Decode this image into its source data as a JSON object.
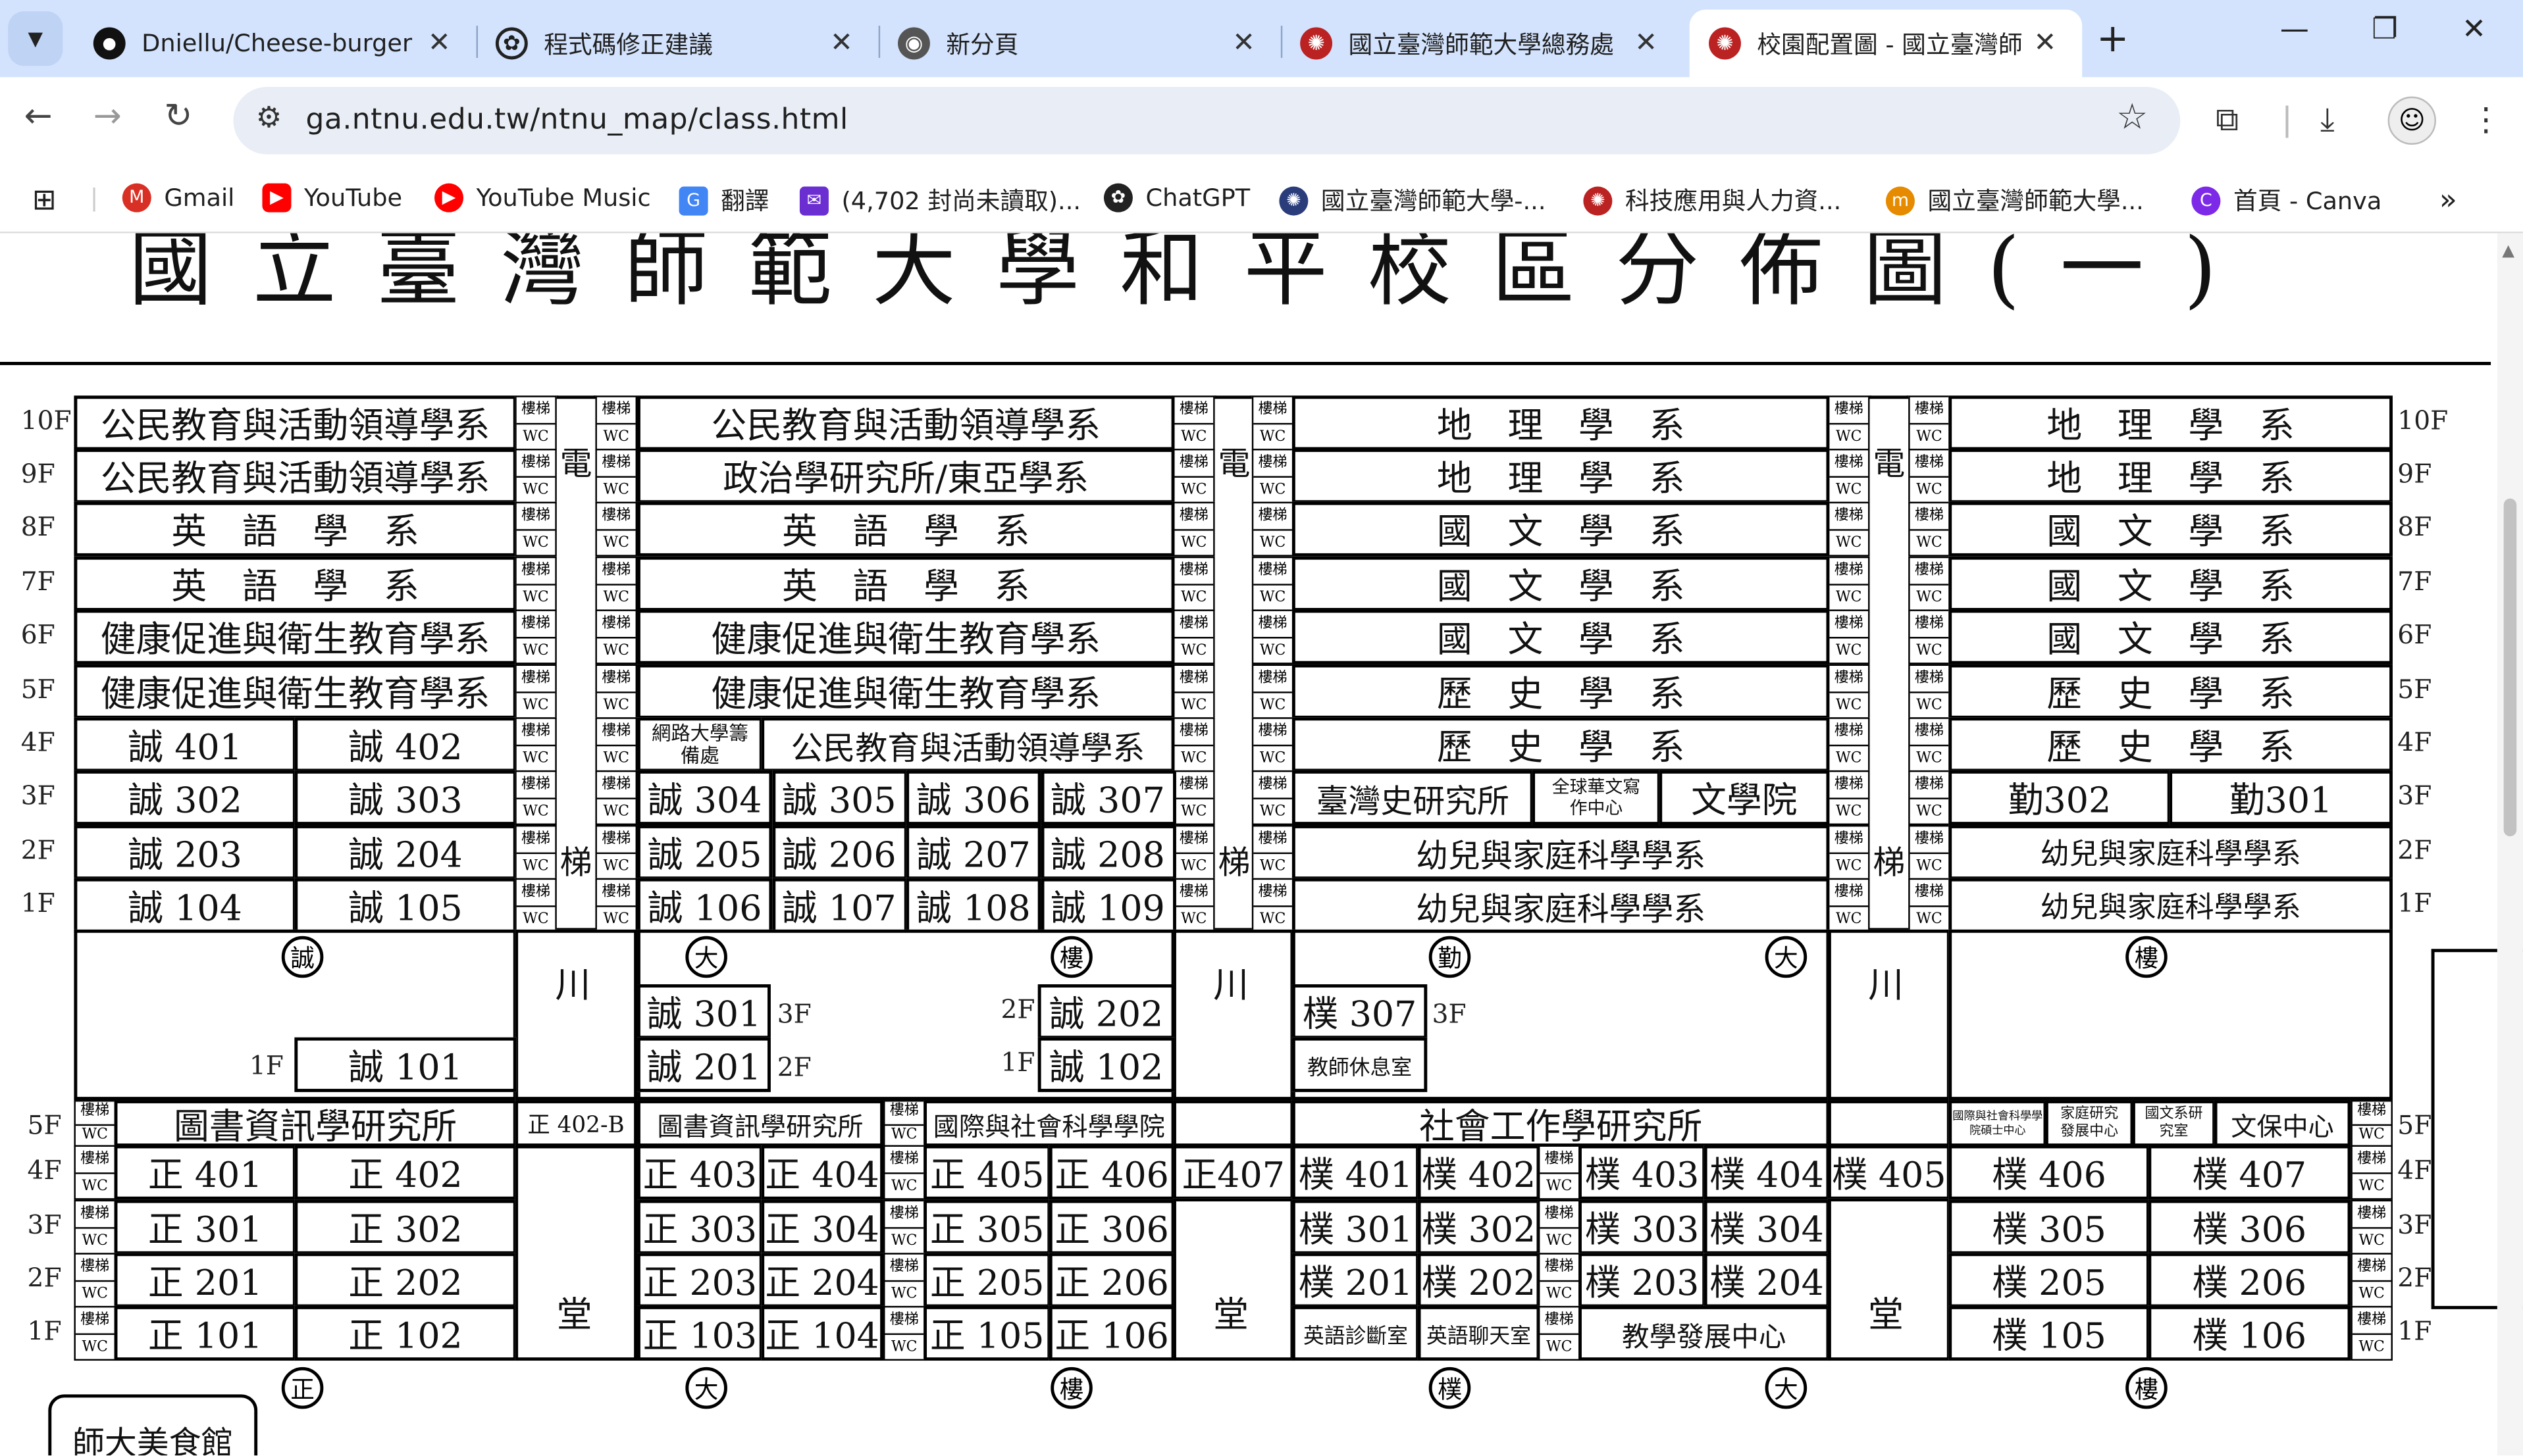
{
  "tabs": [
    {
      "icon": "github-icon",
      "title": "Dniellu/Cheese-burger"
    },
    {
      "icon": "openai-icon",
      "title": "程式碼修正建議"
    },
    {
      "icon": "chrome-icon",
      "title": "新分頁"
    },
    {
      "icon": "ntnu-icon",
      "title": "國立臺灣師範大學總務處"
    },
    {
      "icon": "ntnu-icon",
      "title": "校園配置圖 - 國立臺灣師"
    }
  ],
  "url": "ga.ntnu.edu.tw/ntnu_map/class.html",
  "bookmarks": [
    {
      "icon": "gmail-icon",
      "label": "Gmail"
    },
    {
      "icon": "youtube-icon",
      "label": "YouTube"
    },
    {
      "icon": "youtube-music-icon",
      "label": "YouTube Music"
    },
    {
      "icon": "translate-icon",
      "label": "翻譯"
    },
    {
      "icon": "mail-icon",
      "label": "(4,702 封尚未讀取)..."
    },
    {
      "icon": "openai-icon",
      "label": "ChatGPT"
    },
    {
      "icon": "ntnu-icon",
      "label": "國立臺灣師範大學-..."
    },
    {
      "icon": "ntnu-icon",
      "label": "科技應用與人力資..."
    },
    {
      "icon": "ntnu-icon",
      "label": "國立臺灣師範大學..."
    },
    {
      "icon": "canva-icon",
      "label": "首頁 - Canva"
    }
  ],
  "map": {
    "title": "國立臺灣師範大學和平校區分佈圖(一)",
    "floors_upper": [
      "10F",
      "9F",
      "8F",
      "7F",
      "6F",
      "5F",
      "4F",
      "3F",
      "2F",
      "1F"
    ],
    "floors_lower": [
      "5F",
      "4F",
      "3F",
      "2F",
      "1F"
    ],
    "stair_label": "樓梯",
    "wc_label": "WC",
    "elevator_top": "電",
    "elevator_bottom": "梯",
    "corridor": "川",
    "hall": "堂",
    "cheng_a": [
      "公民教育與活動領導學系",
      "公民教育與活動領導學系",
      "英　語　學　系",
      "英　語　學　系",
      "健康促進與衛生教育學系",
      "健康促進與衛生教育學系"
    ],
    "cheng_a_rooms": [
      [
        "誠 401",
        "誠 402"
      ],
      [
        "誠 302",
        "誠 303"
      ],
      [
        "誠 203",
        "誠 204"
      ],
      [
        "誠 104",
        "誠 105"
      ]
    ],
    "cheng_b": [
      "公民教育與活動領導學系",
      "政治學研究所/東亞學系",
      "英　語　學　系",
      "英　語　學　系",
      "健康促進與衛生教育學系",
      "健康促進與衛生教育學系"
    ],
    "cheng_b_4f": [
      "網路大學籌備處",
      "公民教育與活動領導學系"
    ],
    "cheng_b_rooms": [
      [
        "誠 304",
        "誠 305",
        "誠 306",
        "誠 307"
      ],
      [
        "誠 205",
        "誠 206",
        "誠 207",
        "誠 208"
      ],
      [
        "誠 106",
        "誠 107",
        "誠 108",
        "誠 109"
      ]
    ],
    "qin_a": [
      "地　理　學　系",
      "地　理　學　系",
      "國　文　學　系",
      "國　文　學　系",
      "國　文　學　系",
      "歷　史　學　系",
      "歷　史　學　系"
    ],
    "qin_a_3f": [
      "臺灣史研究所",
      "全球華文寫作中心",
      "文學院"
    ],
    "qin_a_2f": "幼兒與家庭科學學系",
    "qin_a_1f": "幼兒與家庭科學學系",
    "qin_b": [
      "地　理　學　系",
      "地　理　學　系",
      "國　文　學　系",
      "國　文　學　系",
      "國　文　學　系",
      "歷　史　學　系",
      "歷　史　學　系"
    ],
    "qin_b_3f": [
      "勤302",
      "勤301"
    ],
    "qin_b_2f": "幼兒與家庭科學學系",
    "qin_b_1f": "幼兒與家庭科學學系",
    "building_marks": [
      "誠",
      "大",
      "樓",
      "勤",
      "大",
      "樓"
    ],
    "mid_rooms": {
      "c301": "誠 301",
      "c201": "誠 201",
      "c202": "誠 202",
      "c102": "誠 102",
      "c101": "誠 101",
      "p307": "樸 307",
      "lounge": "教師休息室",
      "f3": "3F",
      "f2": "2F",
      "f1": "1F"
    },
    "lower_5f": {
      "a": "圖書資訊學研究所",
      "b": "正 402-B",
      "c": "圖書資訊學研究所",
      "d": "國際與社會科學學院",
      "e": "社會工作學研究所",
      "f": "國際與社會科學學院碩士中心",
      "g": "家庭研究發展中心",
      "h": "國文系研究室",
      "i": "文保中心"
    },
    "zheng_rows": [
      [
        "正 401",
        "正 402"
      ],
      [
        "正 301",
        "正 302"
      ],
      [
        "正 201",
        "正 202"
      ],
      [
        "正 101",
        "正 102"
      ]
    ],
    "zheng_b_rows": [
      [
        "正 403",
        "正 404",
        "正 405",
        "正 406"
      ],
      [
        "正 303",
        "正 304",
        "正 305",
        "正 306"
      ],
      [
        "正 203",
        "正 204",
        "正 205",
        "正 206"
      ],
      [
        "正 103",
        "正 104",
        "正 105",
        "正 106"
      ]
    ],
    "z407": "正407",
    "pu_rows": [
      [
        "樸 401",
        "樸 402",
        "樸 403",
        "樸 404"
      ],
      [
        "樸 301",
        "樸 302",
        "樸 303",
        "樸 304"
      ],
      [
        "樸 201",
        "樸 202",
        "樸 203",
        "樸 204"
      ]
    ],
    "pu_1f": [
      "英語診斷室",
      "英語聊天室",
      "教學發展中心"
    ],
    "p405": "樸 405",
    "pu_b_rows": [
      [
        "樸 406",
        "樸 407"
      ],
      [
        "樸 305",
        "樸 306"
      ],
      [
        "樸 205",
        "樸 206"
      ],
      [
        "樸 105",
        "樸 106"
      ]
    ],
    "bottom_marks": [
      "正",
      "大",
      "樓",
      "樸",
      "大",
      "樓"
    ],
    "food_court": "師大美食館"
  }
}
